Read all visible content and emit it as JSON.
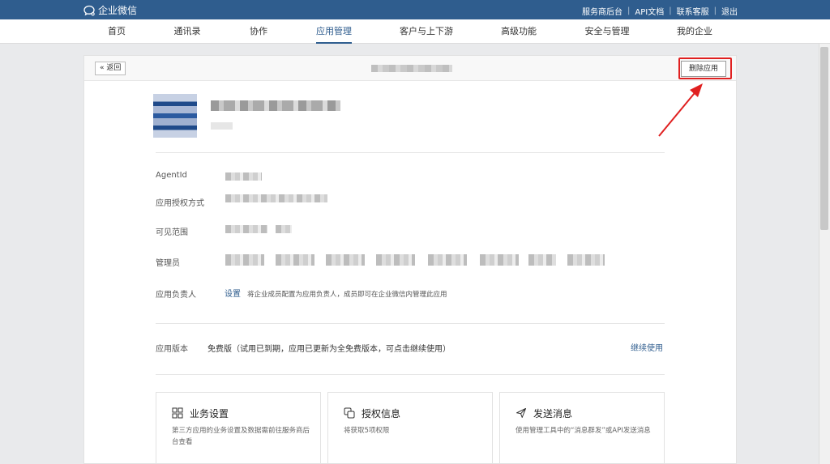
{
  "topbar": {
    "brand": "企业微信",
    "links": [
      "服务商后台",
      "API文档",
      "联系客服",
      "退出"
    ]
  },
  "nav": {
    "items": [
      "首页",
      "通讯录",
      "协作",
      "应用管理",
      "客户与上下游",
      "高级功能",
      "安全与管理",
      "我的企业"
    ],
    "active": "应用管理"
  },
  "header": {
    "back_label": "返回",
    "delete_label": "删除应用"
  },
  "details": {
    "agentid_label": "AgentId",
    "auth_label": "应用授权方式",
    "visible_label": "可见范围",
    "admin_label": "管理员",
    "owner_label": "应用负责人",
    "owner_link": "设置",
    "owner_desc": "将企业成员配置为应用负责人，成员即可在企业微信内管理此应用",
    "version_label": "应用版本",
    "version_text": "免费版（试用已到期，应用已更新为全免费版本，可点击继续使用）",
    "continue_link": "继续使用"
  },
  "features": [
    {
      "icon": "grid-icon",
      "title": "业务设置",
      "desc": "第三方应用的业务设置及数据需前往服务商后台查看"
    },
    {
      "icon": "copy-icon",
      "title": "授权信息",
      "desc": "将获取5项权限"
    },
    {
      "icon": "send-icon",
      "title": "发送消息",
      "desc": "使用管理工具中的“消息群发”或API发送消息"
    }
  ],
  "colors": {
    "brand": "#2f5d8e",
    "highlight": "#e02020"
  }
}
